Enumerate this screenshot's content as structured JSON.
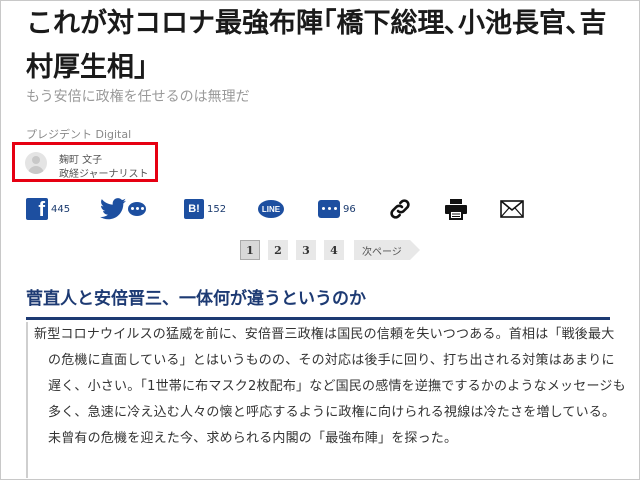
{
  "article": {
    "title": "これが対コロナ最強布陣｢橋下総理､小池長官､吉村厚生相｣",
    "subtitle": "もう安倍に政権を任せるのは無理だ",
    "publisher": "プレジデント Digital",
    "author": {
      "name": "麹町 文子",
      "role": "政経ジャーナリスト"
    }
  },
  "share": {
    "facebook_count": "445",
    "hatena_count": "152",
    "hatena_label": "B!",
    "line_label": "LINE",
    "comment_count": "96"
  },
  "pager": {
    "pages": [
      "1",
      "2",
      "3",
      "4"
    ],
    "current": "1",
    "next_label": "次ページ"
  },
  "section": {
    "heading": "菅直人と安倍晋三、一体何が違うというのか",
    "lead": "新型コロナウイルスの猛威を前に、安倍晋三政権は国民の信頼を失いつつある。首相は「戦後最大の危機に直面している」とはいうものの、その対応は後手に回り、打ち出される対策はあまりに遅く、小さい。「1世帯に布マスク2枚配布」など国民の感情を逆撫でするかのようなメッセージも多く、急速に冷え込む人々の懐と呼応するように政権に向けられる視線は冷たさを増している。未曾有の危機を迎えた今、求められる内閣の「最強布陣」を探った。"
  },
  "colors": {
    "accent": "#1d3a73",
    "icon_blue": "#1d4fa0",
    "highlight_box": "#e60012"
  },
  "icons": [
    "facebook-icon",
    "twitter-icon",
    "hatena-bookmark-icon",
    "line-icon",
    "comment-icon",
    "link-icon",
    "print-icon",
    "mail-icon"
  ]
}
